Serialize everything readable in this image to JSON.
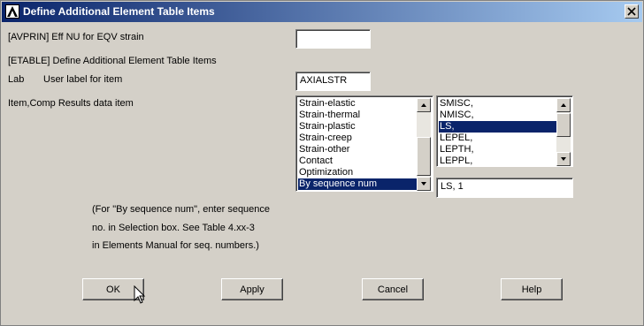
{
  "window": {
    "title": "Define Additional Element Table Items"
  },
  "avprin": {
    "label": "[AVPRIN]  Eff NU for EQV strain",
    "value": ""
  },
  "etable": {
    "label": "[ETABLE]  Define Additional Element Table Items"
  },
  "lab": {
    "label": "Lab",
    "description": "User label for item",
    "value": "AXIALSTR"
  },
  "item_comp": {
    "label": "Item,Comp  Results data item",
    "categories": [
      "Strain-elastic",
      "Strain-thermal",
      "Strain-plastic",
      "Strain-creep",
      "Strain-other",
      "Contact",
      "Optimization",
      "By sequence num"
    ],
    "category_selected": "By sequence num",
    "components": [
      "SMISC,",
      "NMISC,",
      "LS,",
      "LEPEL,",
      "LEPTH,",
      "LEPPL,"
    ],
    "component_selected": "LS,",
    "selection_value": "LS, 1"
  },
  "note": {
    "line1": "(For \"By sequence num\", enter sequence",
    "line2": "no. in Selection box.  See Table 4.xx-3",
    "line3": "in Elements Manual for seq. numbers.)"
  },
  "buttons": {
    "ok": "OK",
    "apply": "Apply",
    "cancel": "Cancel",
    "help": "Help"
  },
  "icons": {
    "app": "ansys-logo-icon",
    "close": "close-icon"
  },
  "colors": {
    "titlebar_start": "#0a246a",
    "selection": "#0a246a",
    "face": "#d4d0c8"
  }
}
